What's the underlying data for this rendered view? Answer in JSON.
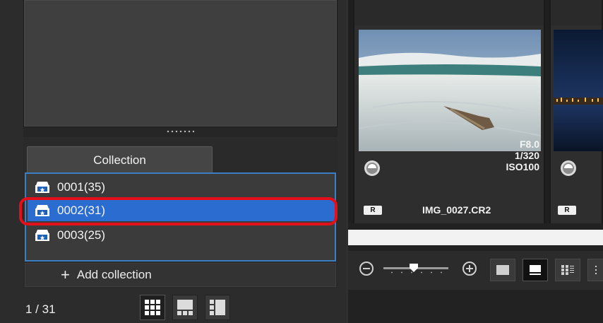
{
  "collection_panel": {
    "tab_label": "Collection",
    "items": [
      {
        "label": "0001(35)",
        "selected": false
      },
      {
        "label": "0002(31)",
        "selected": true
      },
      {
        "label": "0003(25)",
        "selected": false
      }
    ],
    "add_label": "Add collection"
  },
  "status_bar": {
    "page_count": "1 / 31"
  },
  "thumbnails": [
    {
      "aperture": "F8.0",
      "shutter": "1/320",
      "iso": "ISO100",
      "badge": "R",
      "filename": "IMG_0027.CR2"
    },
    {
      "badge": "R"
    }
  ],
  "colors": {
    "selection": "#2a6cd0",
    "list_border": "#3a7fc4",
    "highlight_ring": "#e3101a"
  }
}
